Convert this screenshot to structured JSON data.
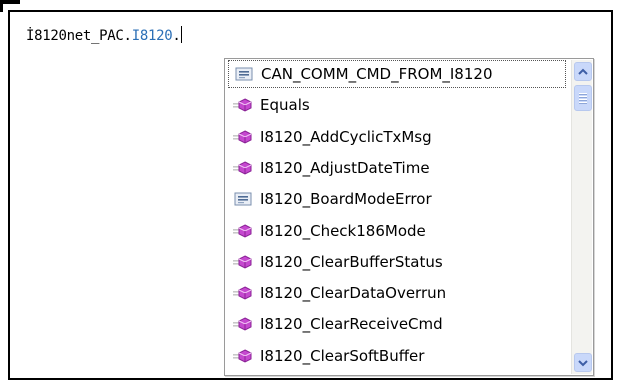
{
  "editor": {
    "object_text": "İ8120net_PAC.",
    "member_text": "I8120",
    "trailing_text": "."
  },
  "completion": {
    "items": [
      {
        "label": "CAN_COMM_CMD_FROM_I8120",
        "icon": "enum-icon",
        "selected": true
      },
      {
        "label": "Equals",
        "icon": "method-icon",
        "selected": false
      },
      {
        "label": "I8120_AddCyclicTxMsg",
        "icon": "method-icon",
        "selected": false
      },
      {
        "label": "I8120_AdjustDateTime",
        "icon": "method-icon",
        "selected": false
      },
      {
        "label": "I8120_BoardModeError",
        "icon": "enum-icon",
        "selected": false
      },
      {
        "label": "I8120_Check186Mode",
        "icon": "method-icon",
        "selected": false
      },
      {
        "label": "I8120_ClearBufferStatus",
        "icon": "method-icon",
        "selected": false
      },
      {
        "label": "I8120_ClearDataOverrun",
        "icon": "method-icon",
        "selected": false
      },
      {
        "label": "I8120_ClearReceiveCmd",
        "icon": "method-icon",
        "selected": false
      },
      {
        "label": "I8120_ClearSoftBuffer",
        "icon": "method-icon",
        "selected": false
      }
    ],
    "scrollbar": {
      "up_icon": "chevron-up-icon",
      "down_icon": "chevron-down-icon"
    }
  },
  "colors": {
    "member_text": "#2b6fb6",
    "scrollbar_button": "#c9d8fa",
    "method_icon": "#c040c8",
    "enum_icon": "#5a7fb0"
  }
}
